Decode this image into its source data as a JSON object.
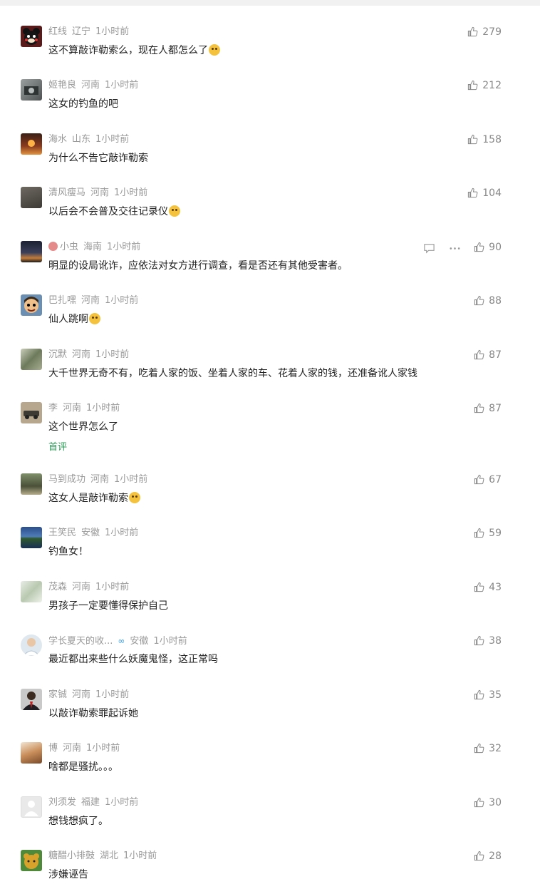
{
  "colors": {
    "first_tag": "#2b9b55",
    "meta": "#999999",
    "text": "#222222"
  },
  "comments": [
    {
      "user": "红线",
      "region": "辽宁",
      "time": "1小时前",
      "text": "这不算敲诈勒索么，现在人都怎么了",
      "emoji": true,
      "likes": "279",
      "avatar": "bear"
    },
    {
      "user": "姬艳良",
      "region": "河南",
      "time": "1小时前",
      "text": "这女的钓鱼的吧",
      "emoji": false,
      "likes": "212",
      "avatar": "photo-grey"
    },
    {
      "user": "海水",
      "region": "山东",
      "time": "1小时前",
      "text": "为什么不告它敲诈勒索",
      "emoji": false,
      "likes": "158",
      "avatar": "photo-red"
    },
    {
      "user": "清风瘦马",
      "region": "河南",
      "time": "1小时前",
      "text": "以后会不会普及交往记录仪",
      "emoji": true,
      "likes": "104",
      "avatar": "photo-dark"
    },
    {
      "user": "小虫",
      "region": "海南",
      "time": "1小时前",
      "text": "明显的设局讹诈，应依法对女方进行调查，看是否还有其他受害者。",
      "emoji": false,
      "likes": "90",
      "avatar": "sunset",
      "hover": true
    },
    {
      "user": "巴扎嘿",
      "region": "河南",
      "time": "1小时前",
      "text": "仙人跳啊",
      "emoji": true,
      "likes": "88",
      "avatar": "cartoon"
    },
    {
      "user": "沉默",
      "region": "河南",
      "time": "1小时前",
      "text": "大千世界无奇不有，吃着人家的饭、坐着人家的车、花着人家的钱，还准备讹人家钱",
      "emoji": false,
      "likes": "87",
      "avatar": "photo-green"
    },
    {
      "user": "李",
      "region": "河南",
      "time": "1小时前",
      "text": "这个世界怎么了",
      "emoji": false,
      "likes": "87",
      "avatar": "car",
      "first": "首评"
    },
    {
      "user": "马到成功",
      "region": "河南",
      "time": "1小时前",
      "text": "这女人是敲诈勒索",
      "emoji": true,
      "likes": "67",
      "avatar": "horses"
    },
    {
      "user": "王笑民",
      "region": "安徽",
      "time": "1小时前",
      "text": "钓鱼女！",
      "emoji": false,
      "likes": "59",
      "avatar": "lake"
    },
    {
      "user": "茂森",
      "region": "河南",
      "time": "1小时前",
      "text": "男孩子一定要懂得保护自己",
      "emoji": false,
      "likes": "43",
      "avatar": "flower"
    },
    {
      "user": "学长夏天的收...",
      "region": "安徽",
      "time": "1小时前",
      "text": "最近都出来些什么妖魔鬼怪，这正常吗",
      "emoji": false,
      "likes": "38",
      "avatar": "doctor",
      "badge": true
    },
    {
      "user": "家铖",
      "region": "河南",
      "time": "1小时前",
      "text": "以敲诈勒索罪起诉她",
      "emoji": false,
      "likes": "35",
      "avatar": "man-suit"
    },
    {
      "user": "博",
      "region": "河南",
      "time": "1小时前",
      "text": "啥都是骚扰。。。",
      "emoji": false,
      "likes": "32",
      "avatar": "photo-warm"
    },
    {
      "user": "刘须发",
      "region": "福建",
      "time": "1小时前",
      "text": "想钱想疯了。",
      "emoji": false,
      "likes": "30",
      "avatar": "default"
    },
    {
      "user": "糖醋小排鼓",
      "region": "湖北",
      "time": "1小时前",
      "text": "涉嫌诬告",
      "emoji": false,
      "likes": "28",
      "avatar": "yellow-cat"
    }
  ]
}
